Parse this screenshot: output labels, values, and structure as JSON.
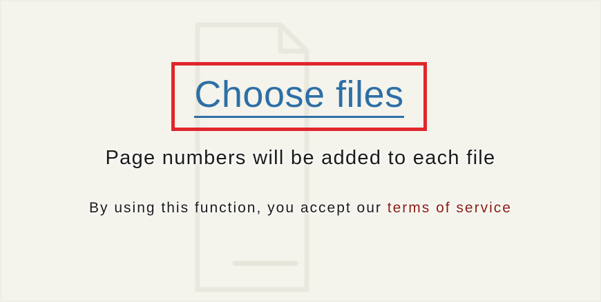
{
  "upload": {
    "choose_label": "Choose files",
    "description": "Page numbers will be added to each file"
  },
  "footer": {
    "prefix": "By using this function, you accept our",
    "terms_link": "terms of service"
  },
  "colors": {
    "background": "#f4f3ec",
    "highlight_frame": "#e0262b",
    "link_blue": "#2d6fa5",
    "terms_red": "#8c1c13",
    "text": "#1b1b1b"
  },
  "icons": {
    "background": "document-icon"
  }
}
